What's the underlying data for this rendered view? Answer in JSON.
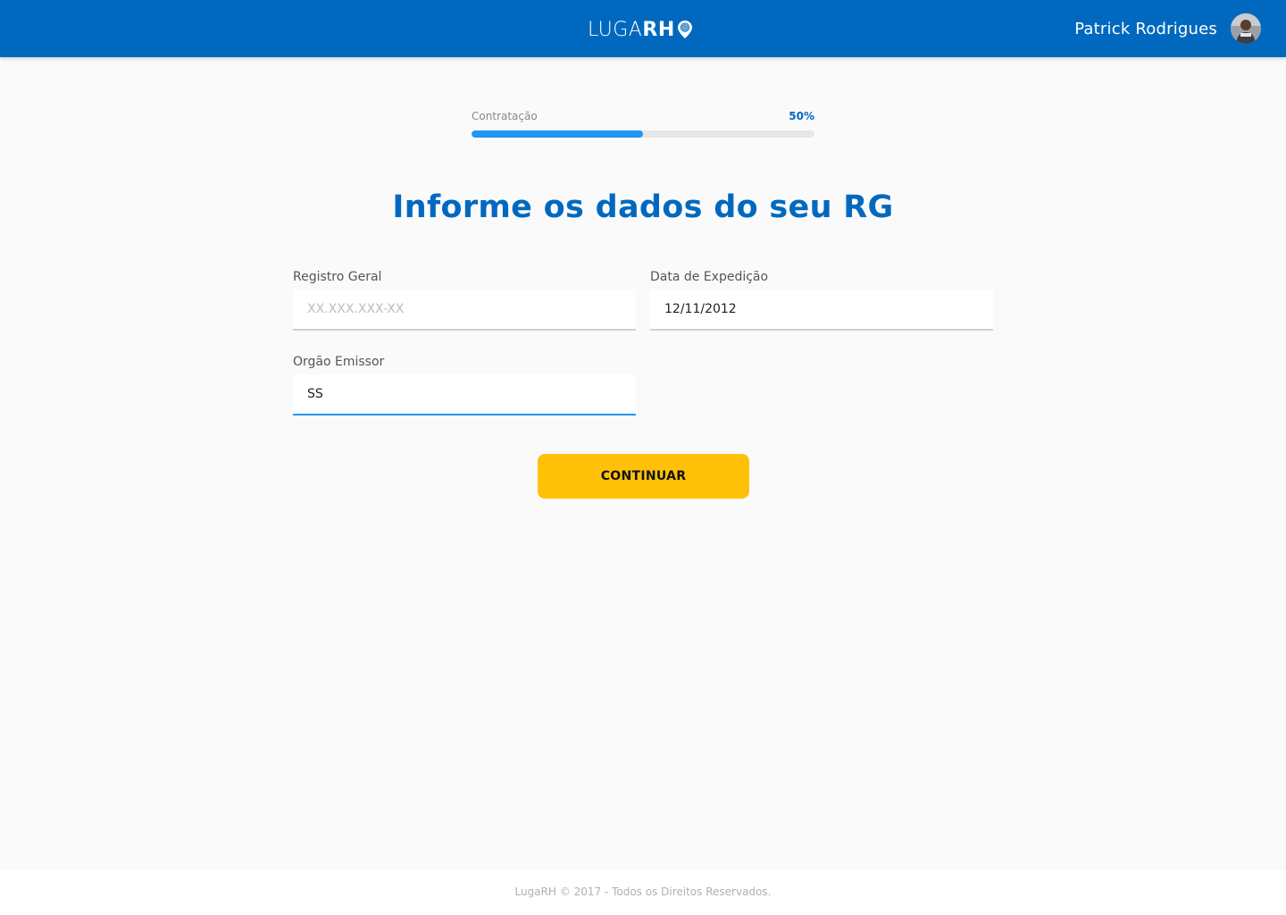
{
  "header": {
    "logo_light": "LUGA",
    "logo_bold": "RH",
    "user_name": "Patrick Rodrigues",
    "brand_color": "#0069bf"
  },
  "progress": {
    "label": "Contratação",
    "value_text": "50%",
    "value": 0.5
  },
  "title": "Informe os dados do seu RG",
  "form": {
    "registro_geral": {
      "label": "Registro Geral",
      "placeholder": "XX.XXX.XXX-XX",
      "value": ""
    },
    "data_expedicao": {
      "label": "Data de Expedição",
      "placeholder": "",
      "value": "12/11/2012"
    },
    "orgao_emissor": {
      "label": "Orgão Emissor",
      "placeholder": "",
      "value": "SS"
    }
  },
  "button": {
    "label": "CONTINUAR",
    "color": "#ffc107"
  },
  "footer": {
    "text": "LugaRH © 2017 - Todos os Direitos Reservados."
  }
}
